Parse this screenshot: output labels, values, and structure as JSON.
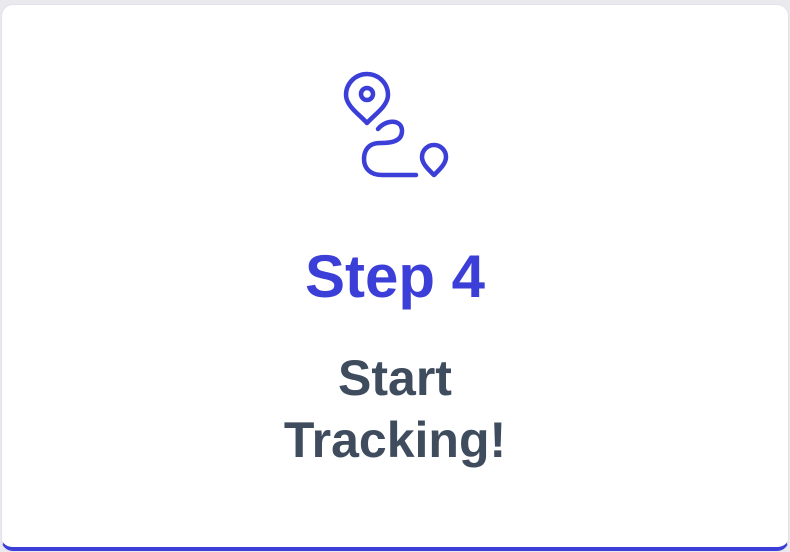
{
  "card": {
    "icon": "route-pin-icon",
    "title": "Step 4",
    "description_lines": [
      "Start",
      "Tracking!"
    ]
  },
  "colors": {
    "accent": "#3b3fd8",
    "text": "#3f4c5e",
    "card_background": "#ffffff"
  }
}
